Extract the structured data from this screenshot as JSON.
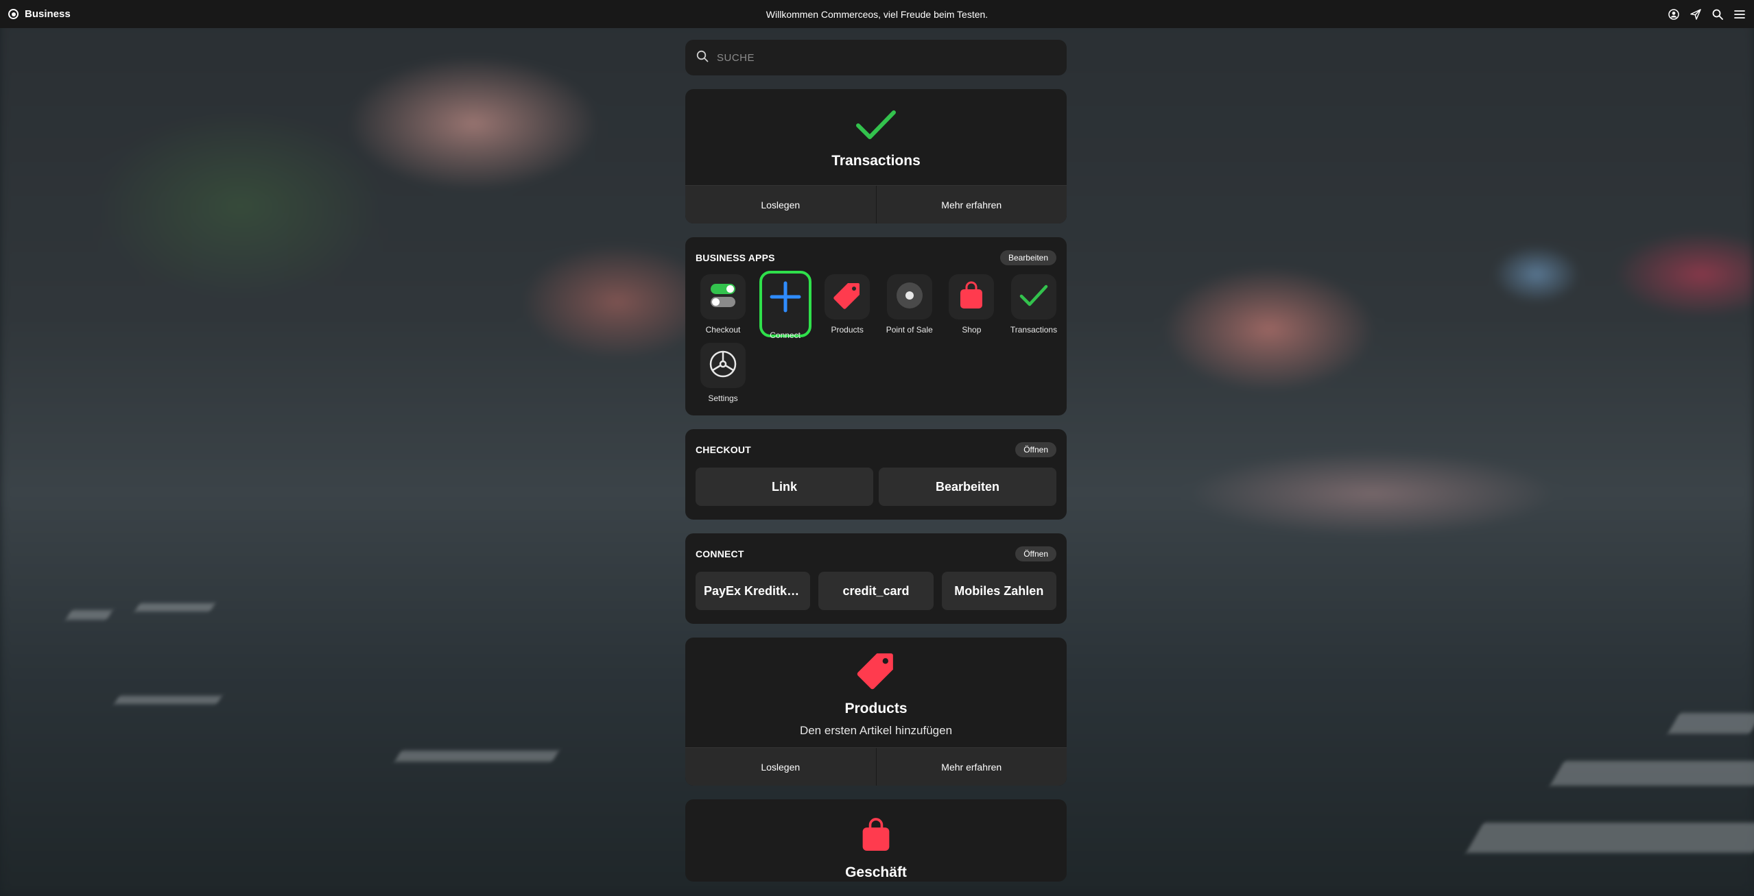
{
  "topbar": {
    "brand": "Business",
    "welcome": "Willkommen Commerceos, viel Freude beim Testen.",
    "icons": [
      "user-circle-icon",
      "paper-plane-icon",
      "search-icon",
      "menu-icon"
    ]
  },
  "search": {
    "placeholder": "SUCHE"
  },
  "transactions_card": {
    "title": "Transactions",
    "start": "Loslegen",
    "learn_more": "Mehr erfahren"
  },
  "business_apps": {
    "title": "BUSINESS APPS",
    "edit": "Bearbeiten",
    "apps": [
      {
        "label": "Checkout",
        "icon": "toggle-switches-icon"
      },
      {
        "label": "Connect",
        "icon": "plus-icon",
        "selected": true
      },
      {
        "label": "Products",
        "icon": "price-tag-icon"
      },
      {
        "label": "Point of Sale",
        "icon": "pos-terminal-icon"
      },
      {
        "label": "Shop",
        "icon": "shopping-bag-icon"
      },
      {
        "label": "Transactions",
        "icon": "checkmark-icon"
      },
      {
        "label": "Settings",
        "icon": "settings-wheel-icon"
      }
    ]
  },
  "checkout": {
    "title": "CHECKOUT",
    "open": "Öffnen",
    "link": "Link",
    "edit": "Bearbeiten"
  },
  "connect": {
    "title": "CONNECT",
    "open": "Öffnen",
    "items": [
      "PayEx Kreditkar...",
      "credit_card",
      "Mobiles Zahlen"
    ]
  },
  "products_card": {
    "title": "Products",
    "subtitle": "Den ersten Artikel hinzufügen",
    "start": "Loslegen",
    "learn_more": "Mehr erfahren"
  },
  "shop_card": {
    "title": "Geschäft"
  },
  "colors": {
    "accent_green": "#2fe04b",
    "check_green": "#33c24d",
    "accent_red": "#ff3b4e",
    "accent_blue": "#2f8cff",
    "card_bg": "#1c1c1c"
  }
}
